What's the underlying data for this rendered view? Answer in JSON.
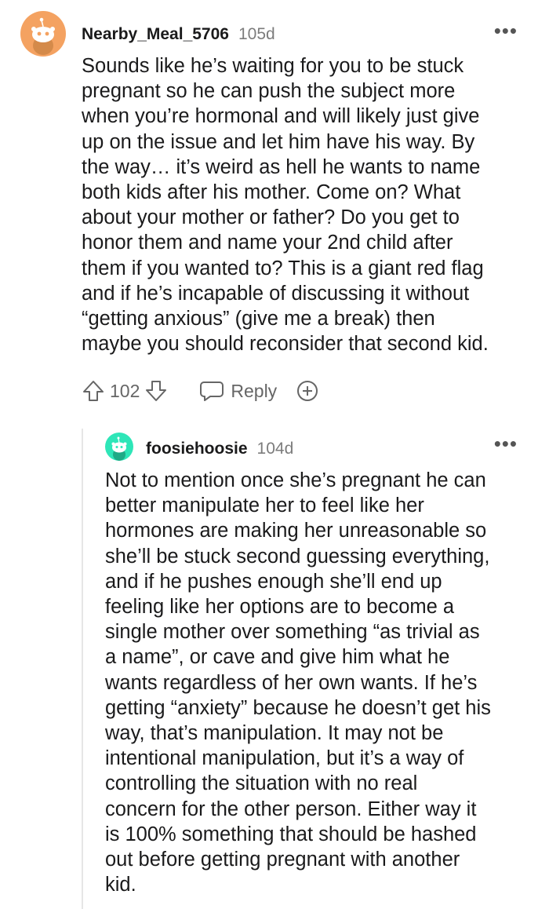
{
  "comments": [
    {
      "username": "Nearby_Meal_5706",
      "age": "105d",
      "avatar_color": "#f4a261",
      "body": "Sounds like he’s waiting for you to be stuck\npregnant so he can push the subject more\nwhen you’re hormonal and will likely just give\nup on the issue and let him have his way. By\nthe way… it’s weird as hell he wants to name\nboth kids after his mother. Come on? What\nabout your mother or father? Do you get to\nhonor them and name your 2nd child after\nthem if you wanted to? This is a giant red flag\nand if he’s incapable of discussing it without\n“getting anxious” (give me a break) then\nmaybe you should reconsider that second kid.",
      "score": "102",
      "reply_label": "Reply"
    },
    {
      "username": "foosiehoosie",
      "age": "104d",
      "avatar_color": "#2ee6b8",
      "body": "Not to mention once she’s pregnant he can\nbetter manipulate her to feel like her\nhormones are making her unreasonable so\nshe’ll be stuck second guessing everything,\nand if he pushes enough she’ll end up\nfeeling like her options are to become a\nsingle mother over something “as trivial as\na name”, or cave and give him what he\nwants regardless of her own wants. If he’s\ngetting “anxiety” because he doesn’t get his\nway, that’s manipulation. It may not be\nintentional manipulation, but it’s a way of\ncontrolling the situation with no real\nconcern for the other person. Either way it\nis 100% something that should be hashed\nout before getting pregnant with another\nkid."
    }
  ],
  "icons": {
    "upvote": "upvote-icon",
    "downvote": "downvote-icon",
    "reply": "reply-icon",
    "award": "award-icon",
    "more": "more-options-icon"
  }
}
